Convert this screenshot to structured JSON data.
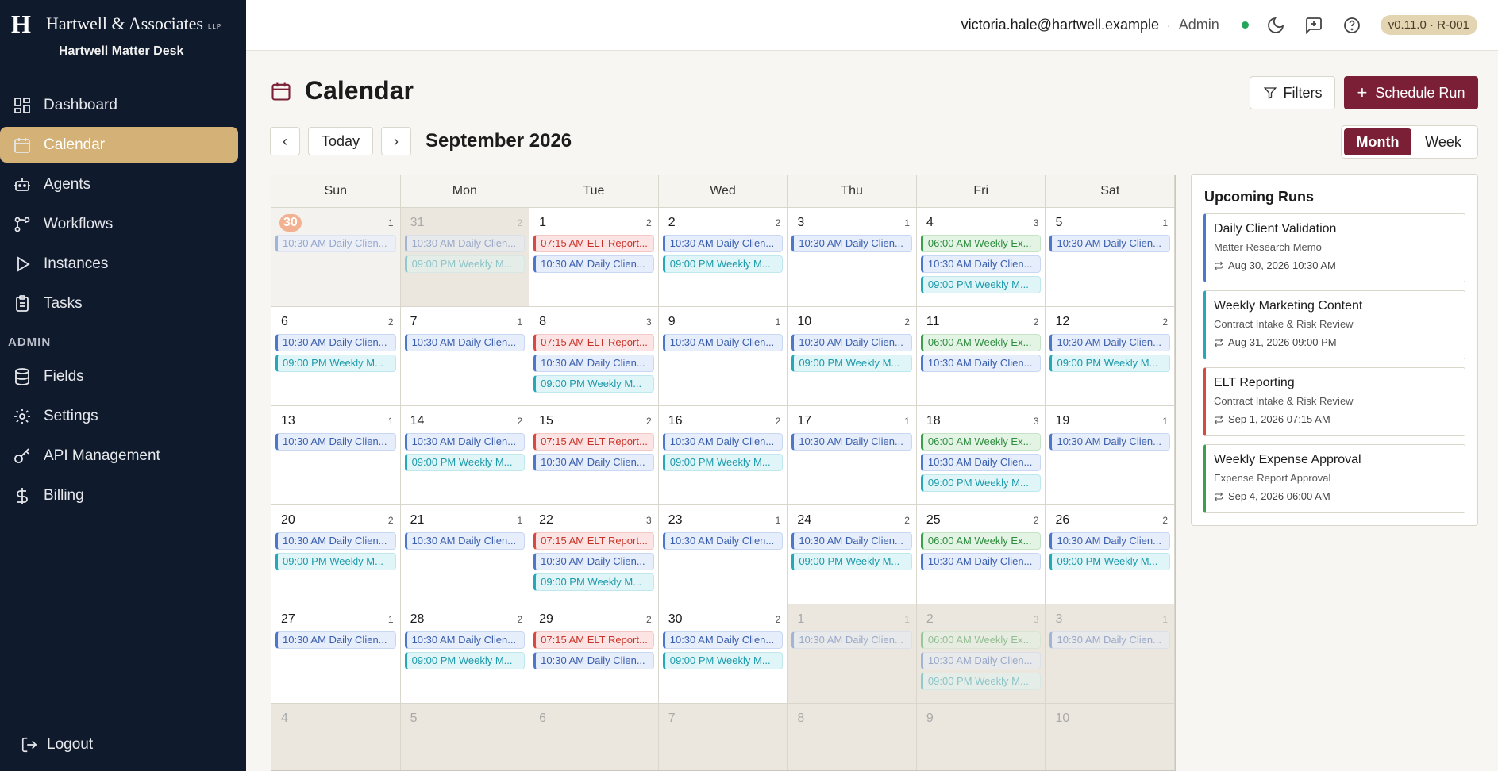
{
  "brand": {
    "logo": "H",
    "name": "Hartwell & Associates",
    "suffix": "LLP",
    "product": "Hartwell Matter Desk"
  },
  "sidebar": {
    "items": [
      {
        "label": "Dashboard",
        "icon": "dashboard-icon"
      },
      {
        "label": "Calendar",
        "icon": "calendar-icon",
        "active": true
      },
      {
        "label": "Agents",
        "icon": "robot-icon"
      },
      {
        "label": "Workflows",
        "icon": "workflow-icon"
      },
      {
        "label": "Instances",
        "icon": "play-icon"
      },
      {
        "label": "Tasks",
        "icon": "clipboard-icon"
      }
    ],
    "admin_section": "ADMIN",
    "admin_items": [
      {
        "label": "Fields",
        "icon": "database-icon"
      },
      {
        "label": "Settings",
        "icon": "gear-icon"
      },
      {
        "label": "API Management",
        "icon": "key-icon"
      },
      {
        "label": "Billing",
        "icon": "dollar-icon"
      }
    ],
    "logout": "Logout"
  },
  "topbar": {
    "email": "victoria.hale@hartwell.example",
    "separator": "·",
    "role": "Admin",
    "version": "v0.11.0 · R-001"
  },
  "page": {
    "title": "Calendar",
    "filters_label": "Filters",
    "schedule_label": "Schedule Run",
    "today_label": "Today",
    "prev_label": "‹",
    "next_label": "›",
    "month_label": "September 2026",
    "view_month": "Month",
    "view_week": "Week"
  },
  "calendar": {
    "weekdays": [
      "Sun",
      "Mon",
      "Tue",
      "Wed",
      "Thu",
      "Fri",
      "Sat"
    ],
    "weeks": [
      [
        {
          "num": "30",
          "count": "1",
          "state": "today",
          "events": [
            {
              "text": "10:30 AM Daily Clien...",
              "color": "blue"
            }
          ]
        },
        {
          "num": "31",
          "count": "2",
          "state": "other",
          "events": [
            {
              "text": "10:30 AM Daily Clien...",
              "color": "blue"
            },
            {
              "text": "09:00 PM Weekly M...",
              "color": "cyan"
            }
          ]
        },
        {
          "num": "1",
          "count": "2",
          "events": [
            {
              "text": "07:15 AM ELT Report...",
              "color": "red"
            },
            {
              "text": "10:30 AM Daily Clien...",
              "color": "blue"
            }
          ]
        },
        {
          "num": "2",
          "count": "2",
          "events": [
            {
              "text": "10:30 AM Daily Clien...",
              "color": "blue"
            },
            {
              "text": "09:00 PM Weekly M...",
              "color": "cyan"
            }
          ]
        },
        {
          "num": "3",
          "count": "1",
          "events": [
            {
              "text": "10:30 AM Daily Clien...",
              "color": "blue"
            }
          ]
        },
        {
          "num": "4",
          "count": "3",
          "events": [
            {
              "text": "06:00 AM Weekly Ex...",
              "color": "green"
            },
            {
              "text": "10:30 AM Daily Clien...",
              "color": "blue"
            },
            {
              "text": "09:00 PM Weekly M...",
              "color": "cyan"
            }
          ]
        },
        {
          "num": "5",
          "count": "1",
          "events": [
            {
              "text": "10:30 AM Daily Clien...",
              "color": "blue"
            }
          ]
        }
      ],
      [
        {
          "num": "6",
          "count": "2",
          "events": [
            {
              "text": "10:30 AM Daily Clien...",
              "color": "blue"
            },
            {
              "text": "09:00 PM Weekly M...",
              "color": "cyan"
            }
          ]
        },
        {
          "num": "7",
          "count": "1",
          "events": [
            {
              "text": "10:30 AM Daily Clien...",
              "color": "blue"
            }
          ]
        },
        {
          "num": "8",
          "count": "3",
          "events": [
            {
              "text": "07:15 AM ELT Report...",
              "color": "red"
            },
            {
              "text": "10:30 AM Daily Clien...",
              "color": "blue"
            },
            {
              "text": "09:00 PM Weekly M...",
              "color": "cyan"
            }
          ]
        },
        {
          "num": "9",
          "count": "1",
          "events": [
            {
              "text": "10:30 AM Daily Clien...",
              "color": "blue"
            }
          ]
        },
        {
          "num": "10",
          "count": "2",
          "events": [
            {
              "text": "10:30 AM Daily Clien...",
              "color": "blue"
            },
            {
              "text": "09:00 PM Weekly M...",
              "color": "cyan"
            }
          ]
        },
        {
          "num": "11",
          "count": "2",
          "events": [
            {
              "text": "06:00 AM Weekly Ex...",
              "color": "green"
            },
            {
              "text": "10:30 AM Daily Clien...",
              "color": "blue"
            }
          ]
        },
        {
          "num": "12",
          "count": "2",
          "events": [
            {
              "text": "10:30 AM Daily Clien...",
              "color": "blue"
            },
            {
              "text": "09:00 PM Weekly M...",
              "color": "cyan"
            }
          ]
        }
      ],
      [
        {
          "num": "13",
          "count": "1",
          "events": [
            {
              "text": "10:30 AM Daily Clien...",
              "color": "blue"
            }
          ]
        },
        {
          "num": "14",
          "count": "2",
          "events": [
            {
              "text": "10:30 AM Daily Clien...",
              "color": "blue"
            },
            {
              "text": "09:00 PM Weekly M...",
              "color": "cyan"
            }
          ]
        },
        {
          "num": "15",
          "count": "2",
          "events": [
            {
              "text": "07:15 AM ELT Report...",
              "color": "red"
            },
            {
              "text": "10:30 AM Daily Clien...",
              "color": "blue"
            }
          ]
        },
        {
          "num": "16",
          "count": "2",
          "events": [
            {
              "text": "10:30 AM Daily Clien...",
              "color": "blue"
            },
            {
              "text": "09:00 PM Weekly M...",
              "color": "cyan"
            }
          ]
        },
        {
          "num": "17",
          "count": "1",
          "events": [
            {
              "text": "10:30 AM Daily Clien...",
              "color": "blue"
            }
          ]
        },
        {
          "num": "18",
          "count": "3",
          "events": [
            {
              "text": "06:00 AM Weekly Ex...",
              "color": "green"
            },
            {
              "text": "10:30 AM Daily Clien...",
              "color": "blue"
            },
            {
              "text": "09:00 PM Weekly M...",
              "color": "cyan"
            }
          ]
        },
        {
          "num": "19",
          "count": "1",
          "events": [
            {
              "text": "10:30 AM Daily Clien...",
              "color": "blue"
            }
          ]
        }
      ],
      [
        {
          "num": "20",
          "count": "2",
          "events": [
            {
              "text": "10:30 AM Daily Clien...",
              "color": "blue"
            },
            {
              "text": "09:00 PM Weekly M...",
              "color": "cyan"
            }
          ]
        },
        {
          "num": "21",
          "count": "1",
          "events": [
            {
              "text": "10:30 AM Daily Clien...",
              "color": "blue"
            }
          ]
        },
        {
          "num": "22",
          "count": "3",
          "events": [
            {
              "text": "07:15 AM ELT Report...",
              "color": "red"
            },
            {
              "text": "10:30 AM Daily Clien...",
              "color": "blue"
            },
            {
              "text": "09:00 PM Weekly M...",
              "color": "cyan"
            }
          ]
        },
        {
          "num": "23",
          "count": "1",
          "events": [
            {
              "text": "10:30 AM Daily Clien...",
              "color": "blue"
            }
          ]
        },
        {
          "num": "24",
          "count": "2",
          "events": [
            {
              "text": "10:30 AM Daily Clien...",
              "color": "blue"
            },
            {
              "text": "09:00 PM Weekly M...",
              "color": "cyan"
            }
          ]
        },
        {
          "num": "25",
          "count": "2",
          "events": [
            {
              "text": "06:00 AM Weekly Ex...",
              "color": "green"
            },
            {
              "text": "10:30 AM Daily Clien...",
              "color": "blue"
            }
          ]
        },
        {
          "num": "26",
          "count": "2",
          "events": [
            {
              "text": "10:30 AM Daily Clien...",
              "color": "blue"
            },
            {
              "text": "09:00 PM Weekly M...",
              "color": "cyan"
            }
          ]
        }
      ],
      [
        {
          "num": "27",
          "count": "1",
          "events": [
            {
              "text": "10:30 AM Daily Clien...",
              "color": "blue"
            }
          ]
        },
        {
          "num": "28",
          "count": "2",
          "events": [
            {
              "text": "10:30 AM Daily Clien...",
              "color": "blue"
            },
            {
              "text": "09:00 PM Weekly M...",
              "color": "cyan"
            }
          ]
        },
        {
          "num": "29",
          "count": "2",
          "events": [
            {
              "text": "07:15 AM ELT Report...",
              "color": "red"
            },
            {
              "text": "10:30 AM Daily Clien...",
              "color": "blue"
            }
          ]
        },
        {
          "num": "30",
          "count": "2",
          "events": [
            {
              "text": "10:30 AM Daily Clien...",
              "color": "blue"
            },
            {
              "text": "09:00 PM Weekly M...",
              "color": "cyan"
            }
          ]
        },
        {
          "num": "1",
          "count": "1",
          "state": "other",
          "events": [
            {
              "text": "10:30 AM Daily Clien...",
              "color": "blue"
            }
          ]
        },
        {
          "num": "2",
          "count": "3",
          "state": "other",
          "events": [
            {
              "text": "06:00 AM Weekly Ex...",
              "color": "green"
            },
            {
              "text": "10:30 AM Daily Clien...",
              "color": "blue"
            },
            {
              "text": "09:00 PM Weekly M...",
              "color": "cyan"
            }
          ]
        },
        {
          "num": "3",
          "count": "1",
          "state": "other",
          "events": [
            {
              "text": "10:30 AM Daily Clien...",
              "color": "blue"
            }
          ]
        }
      ],
      [
        {
          "num": "4",
          "count": "",
          "state": "other",
          "events": []
        },
        {
          "num": "5",
          "count": "",
          "state": "other",
          "events": []
        },
        {
          "num": "6",
          "count": "",
          "state": "other",
          "events": []
        },
        {
          "num": "7",
          "count": "",
          "state": "other",
          "events": []
        },
        {
          "num": "8",
          "count": "",
          "state": "other",
          "events": []
        },
        {
          "num": "9",
          "count": "",
          "state": "other",
          "events": []
        },
        {
          "num": "10",
          "count": "",
          "state": "other",
          "events": []
        }
      ]
    ]
  },
  "upcoming": {
    "title": "Upcoming Runs",
    "runs": [
      {
        "name": "Daily Client Validation",
        "sub": "Matter Research Memo",
        "time": "Aug 30, 2026 10:30 AM",
        "color": "#4d78c9"
      },
      {
        "name": "Weekly Marketing Content",
        "sub": "Contract Intake & Risk Review",
        "time": "Aug 31, 2026 09:00 PM",
        "color": "#27a8b8"
      },
      {
        "name": "ELT Reporting",
        "sub": "Contract Intake & Risk Review",
        "time": "Sep 1, 2026 07:15 AM",
        "color": "#d84a41"
      },
      {
        "name": "Weekly Expense Approval",
        "sub": "Expense Report Approval",
        "time": "Sep 4, 2026 06:00 AM",
        "color": "#3aa04c"
      }
    ]
  }
}
